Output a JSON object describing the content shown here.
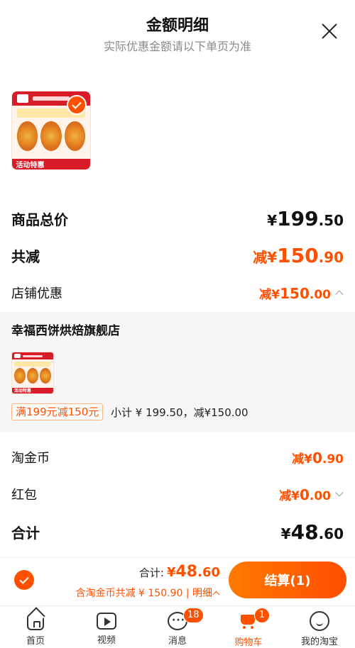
{
  "header": {
    "title": "金额明细",
    "subtitle": "实际优惠金额请以下单页为准"
  },
  "product": {
    "badge_text": "活动特惠"
  },
  "summary": {
    "goods_total": {
      "label": "商品总价",
      "cur": "¥",
      "int": "199",
      "dec": ".50"
    },
    "total_reduce": {
      "label": "共减",
      "prefix": "减¥",
      "int": "150",
      "dec": ".90"
    },
    "shop_discount": {
      "label": "店铺优惠",
      "prefix": "减¥",
      "int": "150",
      "dec": ".00"
    }
  },
  "shop": {
    "name": "幸福西饼烘焙旗舰店",
    "badge_text": "活动特惠",
    "promo_tag": "满199元减150元",
    "subtotal": "小计 ¥ 199.50，减¥150.00"
  },
  "extras": {
    "coins": {
      "label": "淘金币",
      "prefix": "减¥",
      "int": "0",
      "dec": ".90"
    },
    "red_packet": {
      "label": "红包",
      "prefix": "减¥",
      "int": "0",
      "dec": ".00"
    },
    "total": {
      "label": "合计",
      "cur": "¥",
      "int": "48",
      "dec": ".60"
    }
  },
  "bottom_bar": {
    "total_label": "合计:",
    "total_cur": "¥",
    "total_int": "48",
    "total_dec": ".60",
    "discount_text": "含淘金币共减 ¥ 150.90 | 明细",
    "checkout_label": "结算(1)"
  },
  "tabbar": {
    "items": [
      {
        "label": "首页",
        "icon": "home-icon"
      },
      {
        "label": "视频",
        "icon": "video-icon"
      },
      {
        "label": "消息",
        "icon": "message-icon",
        "badge": "18"
      },
      {
        "label": "购物车",
        "icon": "cart-icon",
        "badge": "1"
      },
      {
        "label": "我的淘宝",
        "icon": "profile-icon"
      }
    ]
  },
  "colors": {
    "accent": "#ff5000",
    "text": "#111111",
    "muted": "#8a8a8a",
    "section_bg": "#f6f6f6"
  }
}
